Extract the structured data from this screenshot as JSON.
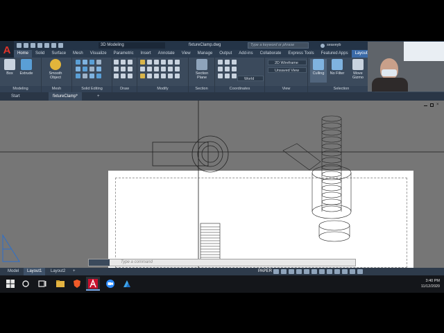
{
  "app": {
    "logo_letter": "A",
    "workspace": "3D Modeling",
    "file_title": "fixtureClamp.dwg",
    "search_placeholder": "Type a keyword or phrase",
    "username": "seaveyb"
  },
  "ribbon_tabs": [
    "Home",
    "Solid",
    "Surface",
    "Mesh",
    "Visualize",
    "Parametric",
    "Insert",
    "Annotate",
    "View",
    "Manage",
    "Output",
    "Add-ins",
    "Collaborate",
    "Express Tools",
    "Featured Apps",
    "Layout"
  ],
  "ribbon": {
    "box_label": "Box",
    "extrude_label": "Extrude",
    "smooth_label": "Smooth Object",
    "section_plane_label": "Section Plane",
    "culling_label": "Culling",
    "no_filter_label": "No Filter",
    "move_gizmo_label": "Move Gizmo",
    "visual_style": "2D Wireframe",
    "view_name": "Unsaved View",
    "ucs": "World",
    "groups": [
      "Modeling",
      "Mesh",
      "Solid Editing",
      "Draw",
      "Modify",
      "Section",
      "Coordinates",
      "View",
      "Selection"
    ]
  },
  "file_tabs": [
    "Start",
    "fixtureClamp*"
  ],
  "command_line": {
    "placeholder": "Type a command"
  },
  "layout_tabs": [
    "Model",
    "Layout1",
    "Layout2"
  ],
  "status": {
    "space": "PAPER"
  },
  "taskbar": {
    "time": "3:40 PM",
    "date": "11/12/2020"
  },
  "colors": {
    "accent": "#3a6aa8",
    "logo": "#e0342a",
    "ribbon": "#3b4a5c",
    "canvas": "#767676"
  }
}
